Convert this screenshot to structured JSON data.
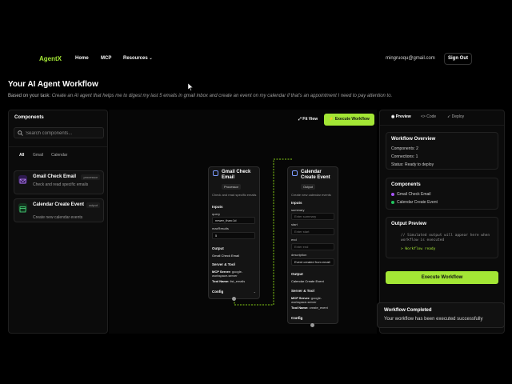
{
  "nav": {
    "logo": "AgentX",
    "links": [
      "Home",
      "MCP",
      "Resources"
    ],
    "resources_chevron": "⌄",
    "user_email": "mingruoqu@gmail.com",
    "signout_label": "Sign Out"
  },
  "page": {
    "title": "Your AI Agent Workflow",
    "task_prefix": "Based on your task: ",
    "task_text": "Create an AI agent that helps me to digest my last 5 emails in gmail inbox and create an event on my calendar if that's an appointment I need to pay attention to."
  },
  "components_panel": {
    "title": "Components",
    "search_placeholder": "Search components...",
    "filters": [
      "All",
      "Gmail",
      "Calendar"
    ],
    "items": [
      {
        "name": "Gmail Check Email",
        "tag": "processor",
        "desc": "Check and read specific emails",
        "icon": "mail-icon",
        "color": "#7c3aed"
      },
      {
        "name": "Calendar Create Event",
        "tag": "output",
        "desc": "Create new calendar events",
        "icon": "calendar-icon",
        "color": "#16a34a"
      }
    ]
  },
  "canvas": {
    "fit_view_label": "Fit View",
    "execute_label": "Execute Workflow",
    "gmail_node": {
      "title": "Gmail Check Email",
      "tag": "Processor",
      "desc": "Check and read specific emails",
      "inputs_label": "Inputs",
      "query_label": "query",
      "query_value": "newer_than:1d",
      "max_label": "maxResults",
      "max_value": "5",
      "output_label": "Output",
      "output_value": "Gmail Check Email",
      "server_label": "Server & Tool",
      "mcp_server_key": "MCP Server:",
      "mcp_server_val": "google-workspace-server",
      "tool_key": "Tool Name:",
      "tool_val": "list_emails",
      "config_label": "Config",
      "chevron": "⌄"
    },
    "calendar_node": {
      "title": "Calendar Create Event",
      "tag": "Output",
      "desc": "Create new calendar events",
      "inputs_label": "Inputs",
      "summary_label": "summary",
      "summary_ph": "Enter summary",
      "start_label": "start",
      "start_ph": "Enter start",
      "end_label": "end",
      "end_ph": "Enter end",
      "desc_label": "description",
      "desc_value": "Event created from email",
      "output_label": "Output",
      "output_value": "Calendar Create Event",
      "server_label": "Server & Tool",
      "mcp_server_key": "MCP Server:",
      "mcp_server_val": "google-workspace-server",
      "tool_key": "Tool Name:",
      "tool_val": "create_event",
      "config_label": "Config",
      "chevron": "⌄"
    }
  },
  "right_panel": {
    "tabs": [
      {
        "label": "Preview",
        "icon": "eye-icon"
      },
      {
        "label": "Code",
        "icon": "code-icon"
      },
      {
        "label": "Deploy",
        "icon": "rocket-icon"
      }
    ],
    "overview": {
      "title": "Workflow Overview",
      "components": "Components: 2",
      "connections": "Connections: 1",
      "status": "Status: Ready to deploy"
    },
    "components": {
      "title": "Components",
      "items": [
        {
          "name": "Gmail Check Email",
          "color": "#a855f7"
        },
        {
          "name": "Calendar Create Event",
          "color": "#22c55e"
        }
      ]
    },
    "output_preview": {
      "title": "Output Preview",
      "comment": "// Simulated output will appear here when workflow is executed",
      "ready": "> Workflow ready"
    },
    "execute_label": "Execute Workflow"
  },
  "toast": {
    "title": "Workflow Completed",
    "body": "Your workflow has been executed successfully"
  },
  "colors": {
    "accent": "#a3e635",
    "background": "#000000"
  }
}
